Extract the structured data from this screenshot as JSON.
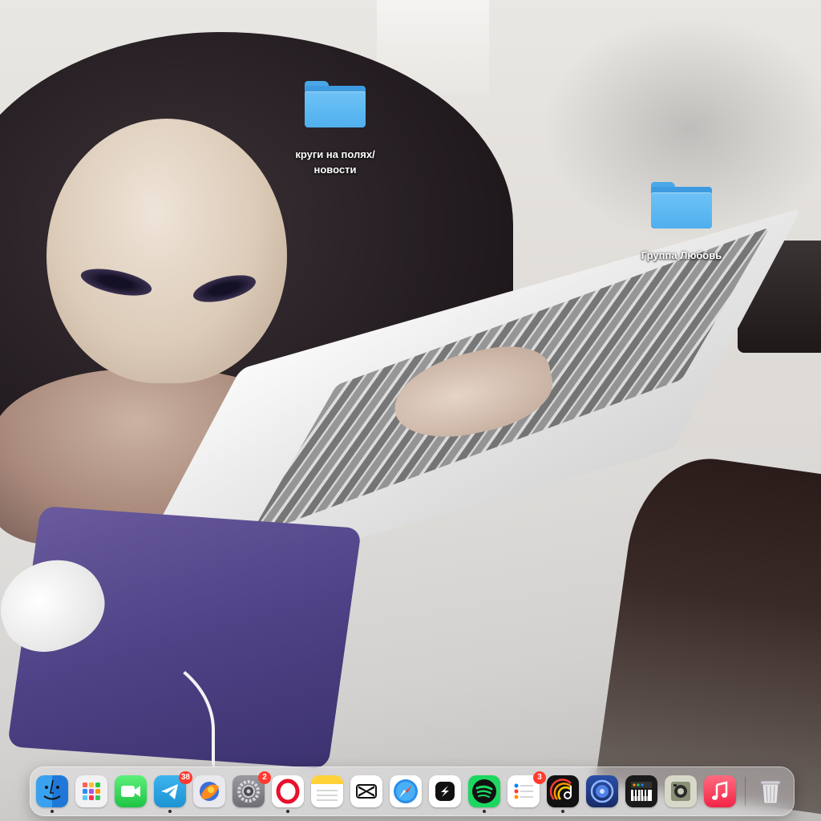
{
  "desktop": {
    "icons": [
      {
        "label": "круги на полях/\nновости",
        "type": "folder"
      },
      {
        "label": "Группа Любовь",
        "type": "folder"
      }
    ]
  },
  "dock": {
    "apps": [
      {
        "icon": "finder-icon",
        "running": true,
        "badge": null
      },
      {
        "icon": "launchpad-icon",
        "running": false,
        "badge": null
      },
      {
        "icon": "facetime-icon",
        "running": false,
        "badge": null
      },
      {
        "icon": "telegram-icon",
        "running": true,
        "badge": "38"
      },
      {
        "icon": "browser-icon",
        "running": false,
        "badge": null
      },
      {
        "icon": "system-settings-icon",
        "running": false,
        "badge": "2"
      },
      {
        "icon": "opera-icon",
        "running": true,
        "badge": null
      },
      {
        "icon": "notes-icon",
        "running": false,
        "badge": null
      },
      {
        "icon": "capcut-icon",
        "running": false,
        "badge": null
      },
      {
        "icon": "safari-icon",
        "running": false,
        "badge": null
      },
      {
        "icon": "shortcut-icon",
        "running": false,
        "badge": null
      },
      {
        "icon": "spotify-icon",
        "running": true,
        "badge": null
      },
      {
        "icon": "reminders-icon",
        "running": false,
        "badge": "3"
      },
      {
        "icon": "music-player-icon",
        "running": true,
        "badge": null
      },
      {
        "icon": "app-store-circle-icon",
        "running": false,
        "badge": null
      },
      {
        "icon": "piano-app-icon",
        "running": false,
        "badge": null
      },
      {
        "icon": "camera-app-icon",
        "running": false,
        "badge": null
      },
      {
        "icon": "music-icon",
        "running": false,
        "badge": null
      },
      {
        "icon": "trash-icon",
        "running": false,
        "badge": null
      }
    ]
  },
  "colors": {
    "folder": "#4fb0ee",
    "badge": "#ff3b30"
  }
}
